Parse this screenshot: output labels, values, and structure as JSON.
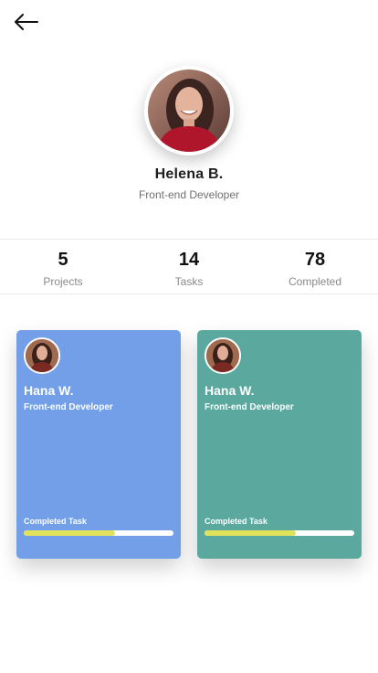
{
  "header": {
    "back_icon": "arrow-left-icon"
  },
  "profile": {
    "name": "Helena B.",
    "role": "Front-end Developer",
    "avatar_icon": "profile-photo"
  },
  "stats": [
    {
      "value": "5",
      "label": "Projects"
    },
    {
      "value": "14",
      "label": "Tasks"
    },
    {
      "value": "78",
      "label": "Completed"
    }
  ],
  "cards": [
    {
      "name": "Hana W.",
      "role": "Front-end Developer",
      "progress_label": "Completed Task",
      "progress": 0.61,
      "color": "#729fe8",
      "progress_color": "#dfe25a"
    },
    {
      "name": "Hana W.",
      "role": "Front-end Developer",
      "progress_label": "Completed Task",
      "progress": 0.61,
      "color": "#5aa89e",
      "progress_color": "#dfe25a"
    }
  ]
}
